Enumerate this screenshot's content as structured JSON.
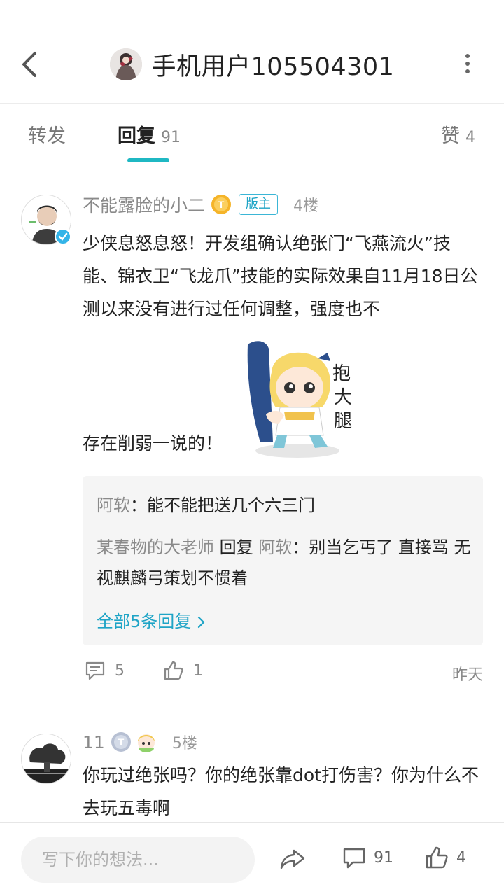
{
  "header": {
    "title": "手机用户105504301"
  },
  "tabs": [
    {
      "label": "转发",
      "count": ""
    },
    {
      "label": "回复",
      "count": "91"
    },
    {
      "label": "赞",
      "count": "4"
    }
  ],
  "comments": [
    {
      "username": "不能露脸的小二",
      "mod_badge": "版主",
      "floor": "4楼",
      "content": "少侠息怒息怒！开发组确认绝张门“飞燕流火”技能、锦衣卫“飞龙爪”技能的实际效果自11月18日公测以来没有进行过任何调整，强度也不",
      "content_after_sticker": "存在削弱一说的！",
      "sticker_text": [
        "抱",
        "大",
        "腿"
      ],
      "replies": [
        {
          "name": "阿软",
          "separator": "：",
          "text": "能不能把送几个六三门"
        },
        {
          "name": "某春物的大老师",
          "reply_word": "回复",
          "target": "阿软",
          "separator": "：",
          "text": "别当乞丐了 直接骂 无视麒麟弓策划不惯着"
        }
      ],
      "more_replies": "全部5条回复",
      "comment_count": "5",
      "like_count": "1",
      "time": "昨天"
    },
    {
      "username": "11",
      "floor": "5楼",
      "content": "你玩过绝张吗？你的绝张靠dot打伤害？你为什么不去玩五毒啊"
    }
  ],
  "bottom_bar": {
    "input_placeholder": "写下你的想法...",
    "comment_count": "91",
    "like_count": "4"
  },
  "colors": {
    "accent": "#1fb8c3",
    "link": "#1ea4c6",
    "muted": "#8a8a8a"
  }
}
